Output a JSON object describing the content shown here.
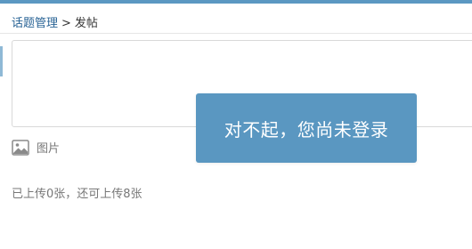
{
  "breadcrumb": {
    "parent": "话题管理",
    "separator": ">",
    "current": "发帖"
  },
  "editor": {
    "placeholder": ""
  },
  "toolbar": {
    "image_icon": "image-icon",
    "image_label": "图片"
  },
  "upload": {
    "status_text": "已上传0张，还可上传8张"
  },
  "toast": {
    "message": "对不起，您尚未登录"
  },
  "colors": {
    "accent": "#5b98c2",
    "toast_bg": "#5a97c1",
    "link": "#2a6496",
    "muted_text": "#777777",
    "border": "#d9d9d9"
  }
}
